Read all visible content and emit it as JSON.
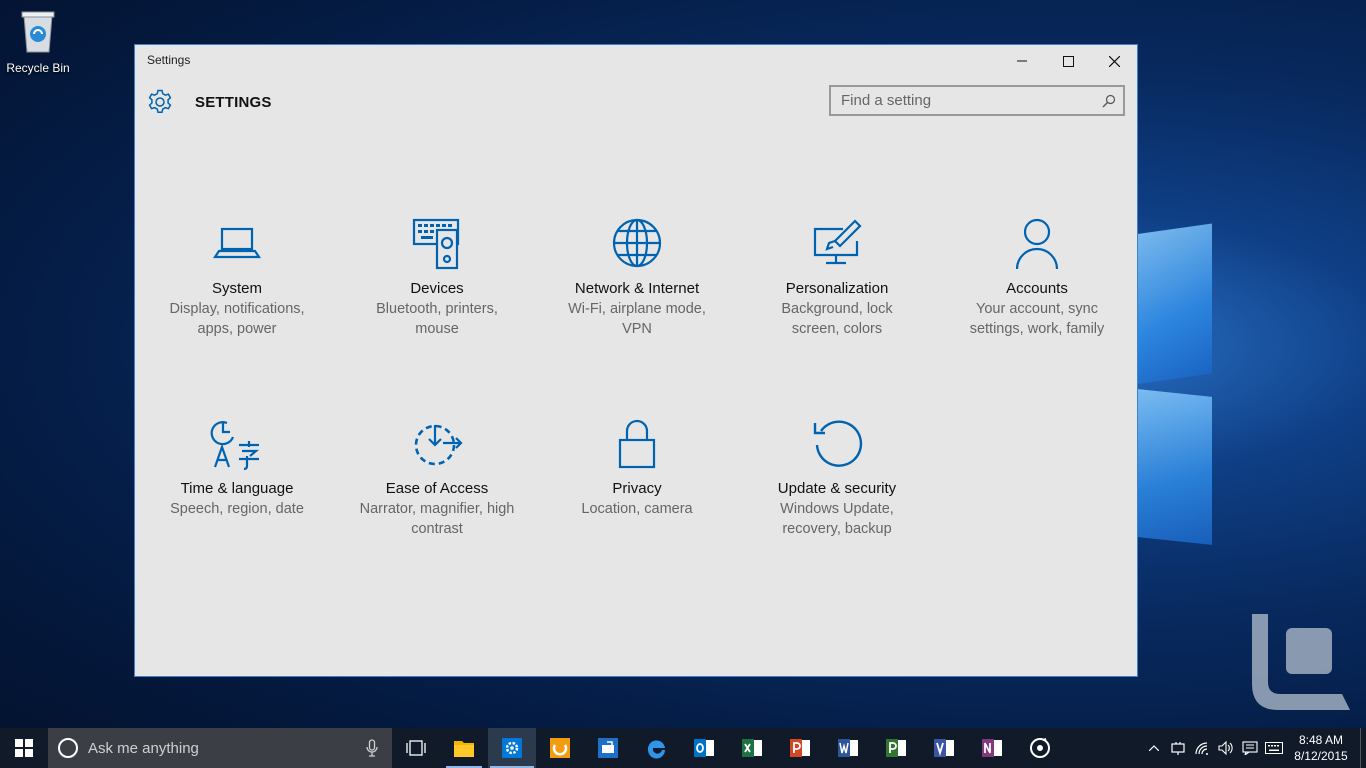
{
  "desktop": {
    "recycle_bin_label": "Recycle Bin"
  },
  "window": {
    "title": "Settings",
    "heading": "SETTINGS",
    "search_placeholder": "Find a setting",
    "accent_color": "#0063b1"
  },
  "tiles": [
    {
      "name": "System",
      "desc": "Display, notifications, apps, power",
      "icon": "laptop-icon"
    },
    {
      "name": "Devices",
      "desc": "Bluetooth, printers, mouse",
      "icon": "keyboard-speaker-icon"
    },
    {
      "name": "Network & Internet",
      "desc": "Wi-Fi, airplane mode, VPN",
      "icon": "globe-icon"
    },
    {
      "name": "Personalization",
      "desc": "Background, lock screen, colors",
      "icon": "monitor-brush-icon"
    },
    {
      "name": "Accounts",
      "desc": "Your account, sync settings, work, family",
      "icon": "person-icon"
    },
    {
      "name": "Time & language",
      "desc": "Speech, region, date",
      "icon": "clock-language-icon"
    },
    {
      "name": "Ease of Access",
      "desc": "Narrator, magnifier, high contrast",
      "icon": "ease-of-access-icon"
    },
    {
      "name": "Privacy",
      "desc": "Location, camera",
      "icon": "lock-icon"
    },
    {
      "name": "Update & security",
      "desc": "Windows Update, recovery, backup",
      "icon": "refresh-icon"
    }
  ],
  "taskbar": {
    "search_placeholder": "Ask me anything",
    "apps": [
      "task-view",
      "file-explorer",
      "settings",
      "app-orange",
      "app-blue",
      "edge",
      "outlook",
      "excel",
      "powerpoint",
      "word",
      "project",
      "visio",
      "onenote",
      "groove"
    ],
    "time": "8:48 AM",
    "date": "8/12/2015"
  }
}
